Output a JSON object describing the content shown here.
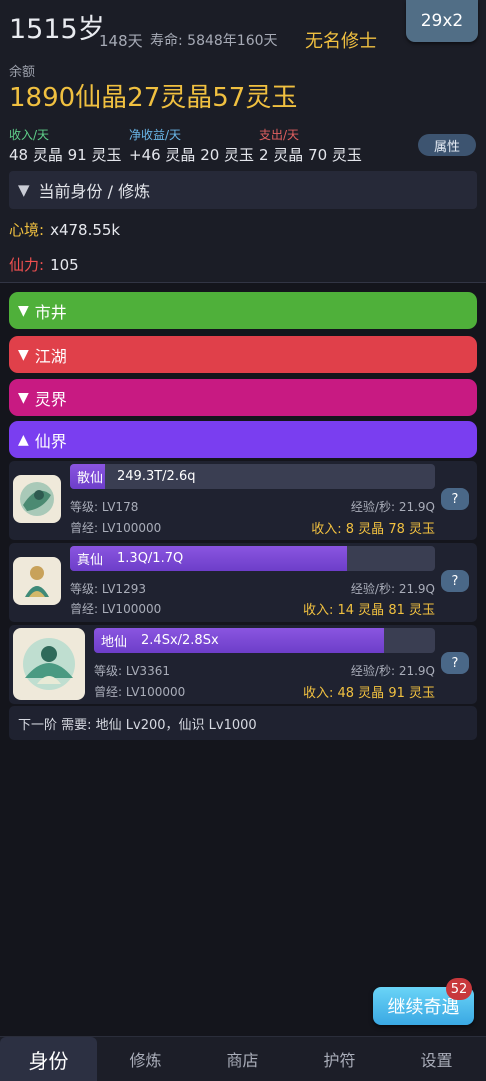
{
  "header": {
    "age": "1515岁",
    "days": "148天",
    "lifespan": "寿命: 5848年160天",
    "title": "无名修士",
    "speed": "29x2"
  },
  "balance": {
    "label": "余额",
    "value": "1890仙晶27灵晶57灵玉"
  },
  "stats": [
    {
      "label": "收入/天",
      "value": "48 灵晶 91 灵玉",
      "color": "#5fd08a"
    },
    {
      "label": "净收益/天",
      "value": "+46 灵晶 20 灵玉",
      "color": "#6ab7e8"
    },
    {
      "label": "支出/天",
      "value": "2 灵晶 70 灵玉",
      "color": "#e06060"
    }
  ],
  "attr_button": "属性",
  "identity_section": {
    "title": "当前身份 / 修炼",
    "expanded": true,
    "xinjing": {
      "label": "心境:",
      "value": "x478.55k",
      "color": "#f0c040"
    },
    "xianli": {
      "label": "仙力:",
      "value": "105",
      "color": "#f05050"
    }
  },
  "bands": [
    {
      "label": "市井",
      "icon": "triangle-down-icon",
      "color": "#4fb03a"
    },
    {
      "label": "江湖",
      "icon": "triangle-down-icon",
      "color": "#e0404a"
    },
    {
      "label": "灵界",
      "icon": "triangle-down-icon",
      "color": "#c81a82"
    },
    {
      "label": "仙界",
      "icon": "triangle-up-icon",
      "color": "#7a3ef0"
    }
  ],
  "ranks": [
    {
      "name": "散仙",
      "progress_text": "249.3T/2.6q",
      "progress": 0.095,
      "level": "等级:  LV178",
      "prev": "曾经:  LV100000",
      "xp": "经验/秒:  21.9Q",
      "income": "收入:  8 灵晶 78 灵玉",
      "help": "?"
    },
    {
      "name": "真仙",
      "progress_text": "1.3Q/1.7Q",
      "progress": 0.76,
      "level": "等级:  LV1293",
      "prev": "曾经:  LV100000",
      "xp": "经验/秒:  21.9Q",
      "income": "收入:  14 灵晶 81 灵玉",
      "help": "?"
    },
    {
      "name": "地仙",
      "progress_text": "2.4Sx/2.8Sx",
      "progress": 0.85,
      "level": "等级:  LV3361",
      "prev": "曾经:  LV100000",
      "xp": "经验/秒:  21.9Q",
      "income": "收入:  48 灵晶 91 灵玉",
      "help": "?"
    }
  ],
  "next_requirement": "下一阶 需要: 地仙 Lv200，仙识 Lv1000",
  "adventure": {
    "label": "继续奇遇",
    "badge": "52"
  },
  "nav": [
    "身份",
    "修炼",
    "商店",
    "护符",
    "设置"
  ],
  "nav_active": 0
}
